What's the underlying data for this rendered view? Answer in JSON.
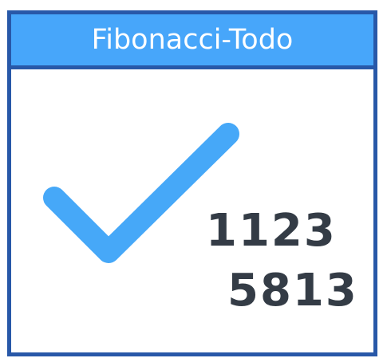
{
  "title": "Fibonacci-Todo",
  "numbers": {
    "row1": "1123",
    "row2": "5813"
  },
  "icon": "checkmark-icon",
  "colors": {
    "border": "#2858a8",
    "header": "#47a6fa",
    "check": "#46a8f8",
    "numbers": "#343c46"
  }
}
